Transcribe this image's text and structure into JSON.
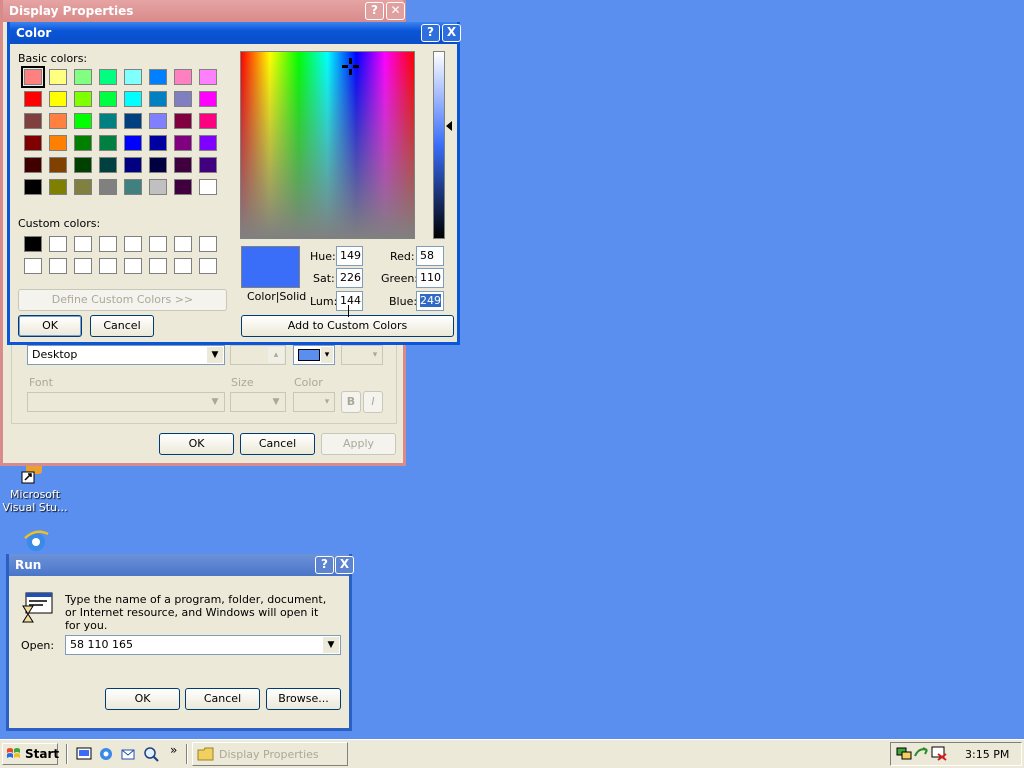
{
  "display_properties": {
    "title": "Display Properties",
    "item_value": "Desktop",
    "font_label": "Font",
    "size_label": "Size",
    "color_label": "Color",
    "bold_label": "B",
    "italic_label": "I",
    "ok_label": "OK",
    "cancel_label": "Cancel",
    "apply_label": "Apply"
  },
  "color_dialog": {
    "title": "Color",
    "help_glyph": "?",
    "close_glyph": "X",
    "basic_colors_label": "Basic colors:",
    "custom_colors_label": "Custom colors:",
    "define_custom_label": "Define Custom Colors >>",
    "ok_label": "OK",
    "cancel_label": "Cancel",
    "add_custom_label": "Add to Custom Colors",
    "color_solid_label": "Color|Solid",
    "hue_label": "Hue:",
    "sat_label": "Sat:",
    "lum_label": "Lum:",
    "red_label": "Red:",
    "green_label": "Green:",
    "blue_label": "Blue:",
    "hue": "149",
    "sat": "226",
    "lum": "144",
    "red": "58",
    "green": "110",
    "blue": "249",
    "current_color": "#3a6ef9",
    "basic_colors": [
      [
        "#ff8080",
        "#ffff80",
        "#80ff80",
        "#00ff80",
        "#80ffff",
        "#0080ff",
        "#ff80c0",
        "#ff80ff"
      ],
      [
        "#ff0000",
        "#ffff00",
        "#80ff00",
        "#00ff40",
        "#00ffff",
        "#0080c0",
        "#8080c0",
        "#ff00ff"
      ],
      [
        "#804040",
        "#ff8040",
        "#00ff00",
        "#008080",
        "#004080",
        "#8080ff",
        "#800040",
        "#ff0080"
      ],
      [
        "#800000",
        "#ff8000",
        "#008000",
        "#008040",
        "#0000ff",
        "#0000a0",
        "#800080",
        "#8000ff"
      ],
      [
        "#400000",
        "#804000",
        "#004000",
        "#004040",
        "#000080",
        "#000040",
        "#400040",
        "#400080"
      ],
      [
        "#000000",
        "#808000",
        "#808040",
        "#808080",
        "#408080",
        "#c0c0c0",
        "#400040",
        "#ffffff"
      ]
    ],
    "custom_colors": [
      [
        "#000000",
        "#ffffff",
        "#ffffff",
        "#ffffff",
        "#ffffff",
        "#ffffff",
        "#ffffff",
        "#ffffff"
      ],
      [
        "#ffffff",
        "#ffffff",
        "#ffffff",
        "#ffffff",
        "#ffffff",
        "#ffffff",
        "#ffffff",
        "#ffffff"
      ]
    ]
  },
  "run_dialog": {
    "title": "Run",
    "help_glyph": "?",
    "close_glyph": "X",
    "description": "Type the name of a program, folder, document, or Internet resource, and Windows will open it for you.",
    "open_label": "Open:",
    "open_value": "58 110 165",
    "ok_label": "OK",
    "cancel_label": "Cancel",
    "browse_label": "Browse..."
  },
  "desktop": {
    "icon_label": "Microsoft Visual Stu..."
  },
  "taskbar": {
    "start_label": "Start",
    "chevron": "»",
    "task_label": "Display Properties",
    "clock": "3:15 PM"
  },
  "colors": {
    "desktop": "#5a8ff0",
    "titlebar_active": "#0a55d8",
    "titlebar_inactive": "#d98a8a"
  }
}
